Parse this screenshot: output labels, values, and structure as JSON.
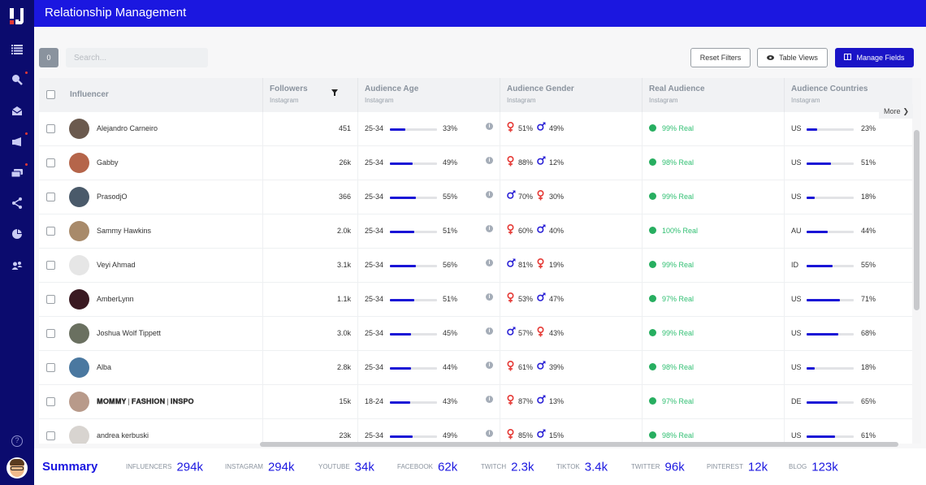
{
  "app": {
    "title": "Relationship Management"
  },
  "sidebar": {
    "items": [
      {
        "name": "list",
        "glyph": "☰",
        "dot": false
      },
      {
        "name": "search",
        "glyph": "⚲",
        "dot": true
      },
      {
        "name": "inbox",
        "glyph": "✉",
        "dot": false
      },
      {
        "name": "campaigns",
        "glyph": "📢",
        "dot": true
      },
      {
        "name": "cards",
        "glyph": "▭",
        "dot": true
      },
      {
        "name": "share",
        "glyph": "⋖",
        "dot": false
      },
      {
        "name": "reports",
        "glyph": "◔",
        "dot": false
      },
      {
        "name": "users",
        "glyph": "👥",
        "dot": false
      }
    ],
    "help_glyph": "?"
  },
  "toolbar": {
    "selected_count": "0",
    "search_placeholder": "Search...",
    "search_value": "",
    "reset_filters_label": "Reset Filters",
    "table_views_label": "Table Views",
    "manage_fields_label": "Manage Fields",
    "eye_glyph": "👁",
    "columns_glyph": "◫"
  },
  "table": {
    "columns": [
      {
        "key": "influencer",
        "label": "Influencer",
        "sub": ""
      },
      {
        "key": "followers",
        "label": "Followers",
        "sub": "Instagram"
      },
      {
        "key": "age",
        "label": "Audience Age",
        "sub": "Instagram"
      },
      {
        "key": "gender",
        "label": "Audience Gender",
        "sub": "Instagram"
      },
      {
        "key": "real",
        "label": "Real Audience",
        "sub": "Instagram"
      },
      {
        "key": "countries",
        "label": "Audience Countries",
        "sub": "Instagram"
      }
    ],
    "filter_glyph": "▼",
    "more_label": "More",
    "more_glyph": "›",
    "rows": [
      {
        "name": "Alejandro Carneiro",
        "followers": "451",
        "age_range": "25-34",
        "age_pct": 33,
        "g1": "female",
        "g1_pct": "51%",
        "g2": "male",
        "g2_pct": "49%",
        "real": "99% Real",
        "country": "US",
        "country_pct": 23,
        "avatar_color": "#6b5a4e"
      },
      {
        "name": "Gabby",
        "followers": "26k",
        "age_range": "25-34",
        "age_pct": 49,
        "g1": "female",
        "g1_pct": "88%",
        "g2": "male",
        "g2_pct": "12%",
        "real": "98% Real",
        "country": "US",
        "country_pct": 51,
        "avatar_color": "#b5654a"
      },
      {
        "name": "PrasodjO",
        "followers": "366",
        "age_range": "25-34",
        "age_pct": 55,
        "g1": "male",
        "g1_pct": "70%",
        "g2": "female",
        "g2_pct": "30%",
        "real": "99% Real",
        "country": "US",
        "country_pct": 18,
        "avatar_color": "#4a5a6a"
      },
      {
        "name": "Sammy Hawkins",
        "followers": "2.0k",
        "age_range": "25-34",
        "age_pct": 51,
        "g1": "female",
        "g1_pct": "60%",
        "g2": "male",
        "g2_pct": "40%",
        "real": "100% Real",
        "country": "AU",
        "country_pct": 44,
        "avatar_color": "#a88a6a"
      },
      {
        "name": "Veyi Ahmad",
        "followers": "3.1k",
        "age_range": "25-34",
        "age_pct": 56,
        "g1": "male",
        "g1_pct": "81%",
        "g2": "female",
        "g2_pct": "19%",
        "real": "99% Real",
        "country": "ID",
        "country_pct": 55,
        "avatar_color": "#e6e6e6"
      },
      {
        "name": "AmberLynn",
        "followers": "1.1k",
        "age_range": "25-34",
        "age_pct": 51,
        "g1": "female",
        "g1_pct": "53%",
        "g2": "male",
        "g2_pct": "47%",
        "real": "97% Real",
        "country": "US",
        "country_pct": 71,
        "avatar_color": "#3a1a22"
      },
      {
        "name": "Joshua Wolf Tippett",
        "followers": "3.0k",
        "age_range": "25-34",
        "age_pct": 45,
        "g1": "male",
        "g1_pct": "57%",
        "g2": "female",
        "g2_pct": "43%",
        "real": "99% Real",
        "country": "US",
        "country_pct": 68,
        "avatar_color": "#6a7060"
      },
      {
        "name": "Alba",
        "followers": "2.8k",
        "age_range": "25-34",
        "age_pct": 44,
        "g1": "female",
        "g1_pct": "61%",
        "g2": "male",
        "g2_pct": "39%",
        "real": "98% Real",
        "country": "US",
        "country_pct": 18,
        "avatar_color": "#4a78a0"
      },
      {
        "name": "𝐌𝐎𝐌𝐌𝐘 | 𝐅𝐀𝐒𝐇𝐈𝐎𝐍 | 𝐈𝐍𝐒𝐏𝐎",
        "followers": "15k",
        "age_range": "18-24",
        "age_pct": 43,
        "g1": "female",
        "g1_pct": "87%",
        "g2": "male",
        "g2_pct": "13%",
        "real": "97% Real",
        "country": "DE",
        "country_pct": 65,
        "avatar_color": "#b89a8a"
      },
      {
        "name": "andrea kerbuski",
        "followers": "23k",
        "age_range": "25-34",
        "age_pct": 49,
        "g1": "female",
        "g1_pct": "85%",
        "g2": "male",
        "g2_pct": "15%",
        "real": "98% Real",
        "country": "US",
        "country_pct": 61,
        "avatar_color": "#d8d4d0"
      }
    ]
  },
  "summary": {
    "title": "Summary",
    "stats": [
      {
        "label": "INFLUENCERS",
        "value": "294k"
      },
      {
        "label": "INSTAGRAM",
        "value": "294k"
      },
      {
        "label": "YOUTUBE",
        "value": "34k"
      },
      {
        "label": "FACEBOOK",
        "value": "62k"
      },
      {
        "label": "TWITCH",
        "value": "2.3k"
      },
      {
        "label": "TIKTOK",
        "value": "3.4k"
      },
      {
        "label": "TWITTER",
        "value": "96k"
      },
      {
        "label": "PINTEREST",
        "value": "12k"
      },
      {
        "label": "BLOG",
        "value": "123k"
      }
    ]
  },
  "colors": {
    "brand": "#1b17e0",
    "sidebar": "#0b0b6e",
    "female": "#e53935",
    "male": "#2b22d6",
    "real": "#2fbf71"
  }
}
